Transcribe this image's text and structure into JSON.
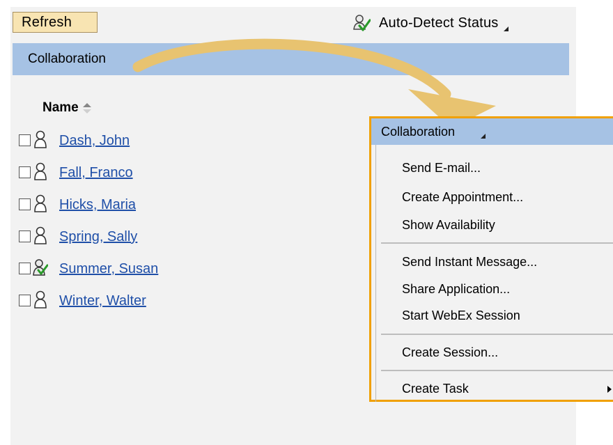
{
  "toolbar": {
    "refresh_label": "Refresh",
    "auto_detect_label": "Auto-Detect Status"
  },
  "collab_bar": {
    "label": "Collaboration"
  },
  "people": {
    "column_header": "Name",
    "rows": [
      {
        "name": "Dash, John",
        "icon": "person-outline-icon"
      },
      {
        "name": "Fall, Franco",
        "icon": "person-outline-icon"
      },
      {
        "name": "Hicks, Maria",
        "icon": "person-outline-icon"
      },
      {
        "name": "Spring, Sally",
        "icon": "person-outline-icon"
      },
      {
        "name": "Summer, Susan",
        "icon": "person-online-icon"
      },
      {
        "name": "Winter, Walter",
        "icon": "person-outline-icon"
      }
    ]
  },
  "menu": {
    "title": "Collaboration",
    "items": [
      "Send E-mail...",
      "Create Appointment...",
      "Show Availability",
      "Send Instant Message...",
      "Share Application...",
      "Start WebEx Session",
      "Create Session...",
      "Create Task"
    ]
  },
  "colors": {
    "accent_border": "#f0a000",
    "header_blue": "#a6c2e4",
    "link": "#1f4fa8",
    "arrow": "#e8c370"
  }
}
